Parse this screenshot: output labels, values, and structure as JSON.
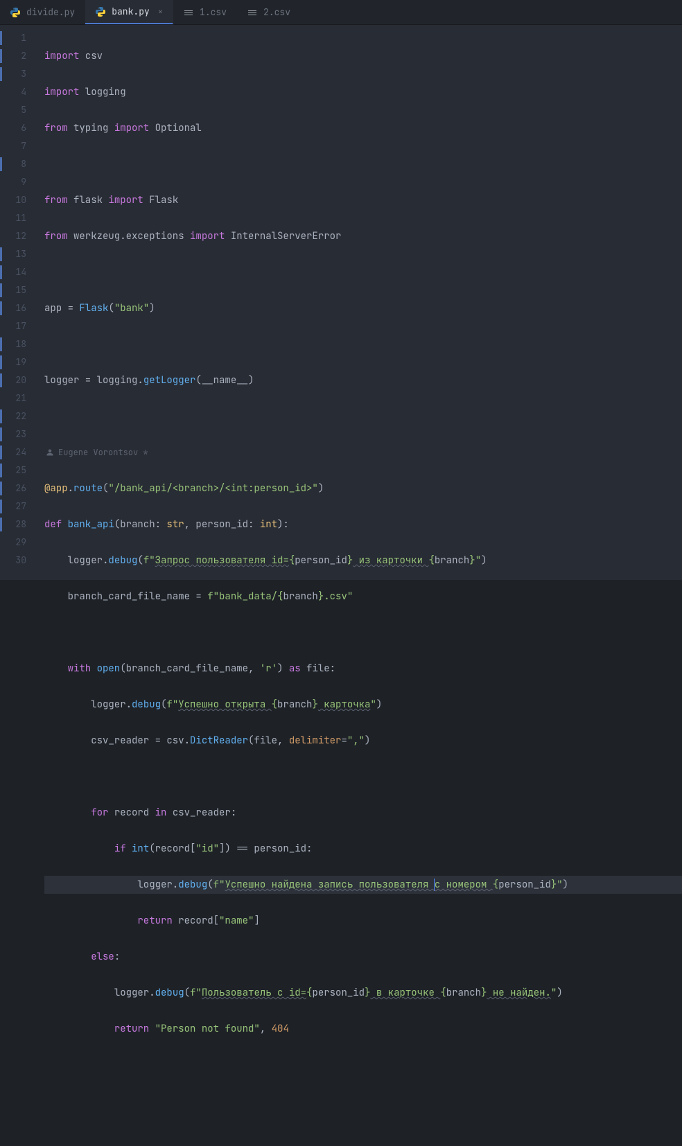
{
  "tabs": [
    {
      "label": "divide.py",
      "icon": "python",
      "active": false,
      "dirty": false
    },
    {
      "label": "bank.py",
      "icon": "python",
      "active": true,
      "dirty": false
    },
    {
      "label": "1.csv",
      "icon": "csv",
      "active": false,
      "dirty": false
    },
    {
      "label": "2.csv",
      "icon": "csv",
      "active": false,
      "dirty": false
    }
  ],
  "close_glyph": "×",
  "author_hint": "Eugene Vorontsov *",
  "gutter": {
    "lines": 30,
    "vcs_marks": [
      1,
      2,
      3,
      8,
      13,
      14,
      15,
      16,
      18,
      19,
      20,
      22,
      23,
      24,
      25,
      26,
      27,
      28
    ]
  },
  "current_line": 24,
  "code": {
    "l1": {
      "kw1": "import",
      "ns1": " csv"
    },
    "l2": {
      "kw1": "import",
      "ns1": " logging"
    },
    "l3": {
      "kw1": "from",
      "ns1": " typing ",
      "kw2": "import",
      "ns2": " Optional"
    },
    "l4": {
      "txt": ""
    },
    "l5": {
      "kw1": "from",
      "ns1": " flask ",
      "kw2": "import",
      "ns2": " Flask"
    },
    "l6": {
      "kw1": "from",
      "ns1": " werkzeug.exceptions ",
      "kw2": "import",
      "ns2": " InternalServerError"
    },
    "l7": {
      "txt": ""
    },
    "l8": {
      "ns1": "app = ",
      "fn1": "Flask",
      "p1": "(",
      "str1": "\"bank\"",
      "p2": ")"
    },
    "l9": {
      "txt": ""
    },
    "l10": {
      "ns1": "logger = logging.",
      "fn1": "getLogger",
      "p1": "(__name__)"
    },
    "l11": {
      "txt": ""
    },
    "l12": {
      "txt": ""
    },
    "l13": {
      "dec1": "@app",
      "ns1": ".",
      "fn1": "route",
      "p1": "(",
      "str1": "\"/bank_api/<branch>/<int:person_id>\"",
      "p2": ")"
    },
    "l14": {
      "kw1": "def ",
      "fn1": "bank_api",
      "p1": "(branch: ",
      "cls1": "str",
      "p2": ", person_id: ",
      "cls2": "int",
      "p3": "):"
    },
    "l15": {
      "indent": "    ",
      "ns1": "logger.",
      "fn1": "debug",
      "p1": "(",
      "fpre": "f\"",
      "s1": "Запрос пользователя id=",
      "e1o": "{",
      "e1": "person_id",
      "e1c": "}",
      "s2": " из карточки ",
      "e2o": "{",
      "e2": "branch",
      "e2c": "}",
      "fpost": "\"",
      "p2": ")"
    },
    "l16": {
      "indent": "    ",
      "ns1": "branch_card_file_name = ",
      "fpre": "f\"",
      "s1": "bank_data/",
      "e1o": "{",
      "e1": "branch",
      "e1c": "}",
      "s2": ".csv",
      "fpost": "\""
    },
    "l17": {
      "txt": ""
    },
    "l18": {
      "indent": "    ",
      "kw1": "with ",
      "fn1": "open",
      "p1": "(branch_card_file_name, ",
      "str1": "'r'",
      "p2": ") ",
      "kw2": "as ",
      "ns1": "file:"
    },
    "l19": {
      "indent": "        ",
      "ns1": "logger.",
      "fn1": "debug",
      "p1": "(",
      "fpre": "f\"",
      "s1": "Успешно открыта ",
      "e1o": "{",
      "e1": "branch",
      "e1c": "}",
      "s2": " карточка",
      "fpost": "\"",
      "p2": ")"
    },
    "l20": {
      "indent": "        ",
      "ns1": "csv_reader = csv.",
      "fn1": "DictReader",
      "p1": "(file, ",
      "param1": "delimiter",
      "eq": "=",
      "str1": "\",\"",
      "p2": ")"
    },
    "l21": {
      "txt": ""
    },
    "l22": {
      "indent": "        ",
      "kw1": "for ",
      "ns1": "record ",
      "kw2": "in ",
      "ns2": "csv_reader:"
    },
    "l23": {
      "indent": "            ",
      "kw1": "if ",
      "fn1": "int",
      "p1": "(record[",
      "str1": "\"id\"",
      "p2": "]) == person_id:"
    },
    "l24": {
      "indent": "                ",
      "ns1": "logger.",
      "fn1": "debug",
      "p1": "(",
      "fpre": "f\"",
      "s1": "Успешно найдена запись пользователя ",
      "s2": "с номером ",
      "e1o": "{",
      "e1": "person_id",
      "e1c": "}",
      "fpost": "\"",
      "p2": ")"
    },
    "l25": {
      "indent": "                ",
      "kw1": "return ",
      "ns1": "record[",
      "str1": "\"name\"",
      "p1": "]"
    },
    "l26": {
      "indent": "        ",
      "kw1": "else",
      "p1": ":"
    },
    "l27": {
      "indent": "            ",
      "ns1": "logger.",
      "fn1": "debug",
      "p1": "(",
      "fpre": "f\"",
      "s1": "Пользователь с id=",
      "e1o": "{",
      "e1": "person_id",
      "e1c": "}",
      "s2": " в карточке ",
      "e2o": "{",
      "e2": "branch",
      "e2c": "}",
      "s3": " не найден.",
      "fpost": "\"",
      "p2": ")"
    },
    "l28": {
      "indent": "            ",
      "kw1": "return ",
      "str1": "\"Person not found\"",
      "p1": ", ",
      "num1": "404"
    },
    "l29": {
      "txt": ""
    },
    "l30": {
      "txt": ""
    }
  }
}
